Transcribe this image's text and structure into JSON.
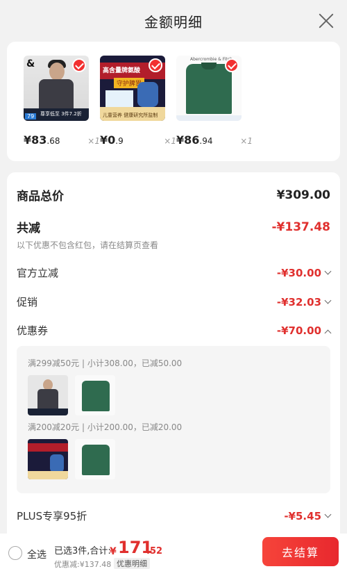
{
  "header": {
    "title": "金额明细"
  },
  "products": [
    {
      "price_int": "¥83",
      "price_dec": ".68",
      "qty": "×1",
      "brand_mark": "&",
      "strip_tag": "79",
      "strip_text": "尊享低至 3件7.2折"
    },
    {
      "price_int": "¥0",
      "price_dec": ".9",
      "qty": "×1",
      "band_text": "高含量牌氨酸",
      "sub_text": "守护脾胃",
      "bar_text": "儿童营养 健康研究所监制"
    },
    {
      "price_int": "¥86",
      "price_dec": ".94",
      "qty": "×1",
      "brand_text": "Abercrombie & Fitch"
    }
  ],
  "breakdown": {
    "total_label": "商品总价",
    "total_value": "¥309.00",
    "reduce_label": "共减",
    "reduce_value": "-¥137.48",
    "reduce_note": "以下优惠不包含红包，请在结算页查看",
    "official_label": "官方立减",
    "official_value": "-¥30.00",
    "promo_label": "促销",
    "promo_value": "-¥32.03",
    "coupon_label": "优惠券",
    "coupon_value": "-¥70.00",
    "coupon_line_1": "满299减50元 | 小计308.00，已减50.00",
    "coupon_line_2": "满200减20元 | 小计200.00，已减20.00",
    "plus_label": "PLUS专享95折",
    "plus_value": "-¥5.45"
  },
  "bottom_bar": {
    "select_all": "全选",
    "summary": "已选3件,合计:",
    "total_symbol": "¥",
    "total_int": "171",
    "total_dec": ".52",
    "discount": "优惠减:¥137.48",
    "detail_button": "优惠明细",
    "checkout_button": "去结算"
  },
  "colors": {
    "accent_red": "#e0302e",
    "checkout_gradient_start": "#f6443a"
  }
}
